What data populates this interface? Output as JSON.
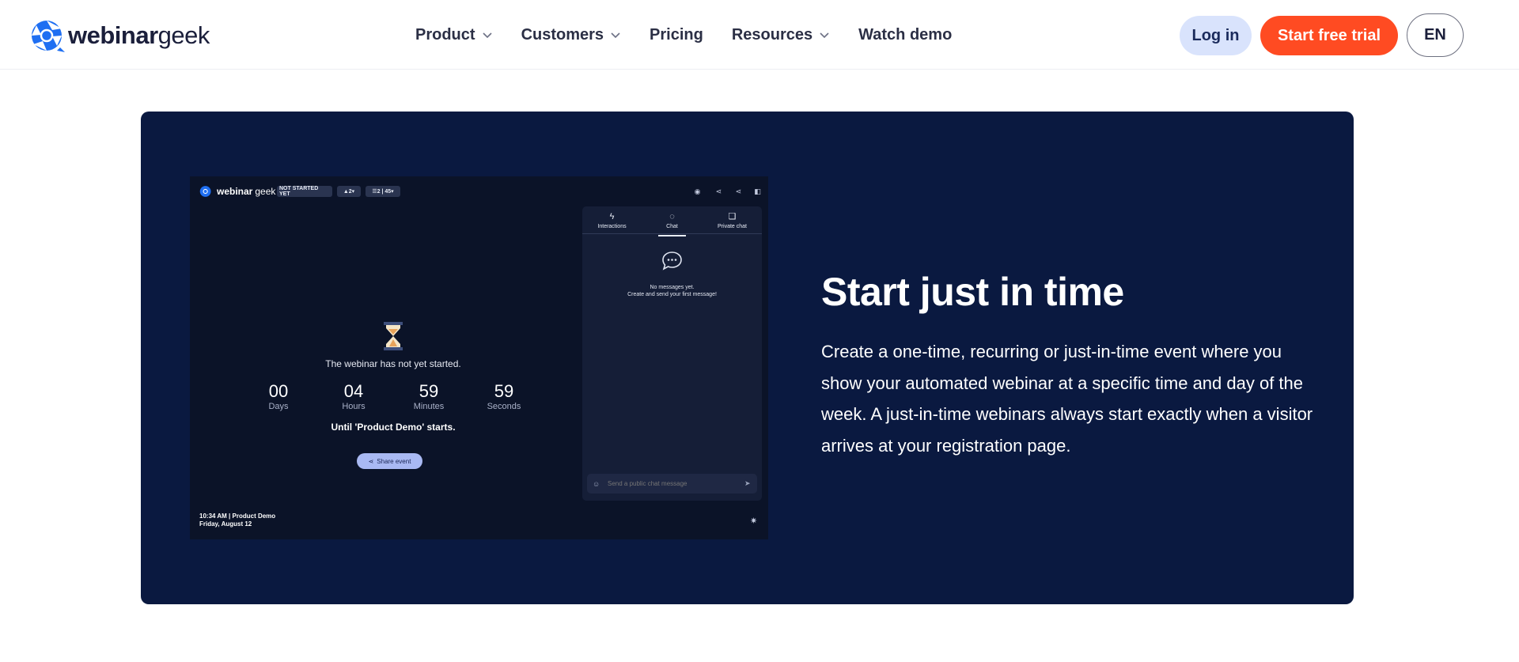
{
  "header": {
    "logo": {
      "part1": "webinar",
      "part2": "geek"
    },
    "nav": [
      {
        "label": "Product",
        "has_dropdown": true
      },
      {
        "label": "Customers",
        "has_dropdown": true
      },
      {
        "label": "Pricing",
        "has_dropdown": false
      },
      {
        "label": "Resources",
        "has_dropdown": true
      },
      {
        "label": "Watch demo",
        "has_dropdown": false
      }
    ],
    "login_label": "Log in",
    "trial_label": "Start free trial",
    "lang_label": "EN"
  },
  "colors": {
    "brand_blue": "#1f6ff2",
    "cta_orange": "#ff4b22",
    "card_navy": "#0a1940",
    "login_bg": "#d9e3fc"
  },
  "hero": {
    "title": "Start just in time",
    "body": "Create a one-time, recurring or just-in-time event where you show your automated webinar at a specific time and day of the week. A just-in-time webinars always start exactly when a visitor arrives at your registration page."
  },
  "preview": {
    "logo": {
      "part1": "webinar",
      "part2": "geek"
    },
    "status_badge": "NOT STARTED YET",
    "badge_presenters": "2",
    "badge_attendees": "2 | 45",
    "not_started_text": "The webinar has not yet started.",
    "countdown": [
      {
        "value": "00",
        "unit": "Days"
      },
      {
        "value": "04",
        "unit": "Hours"
      },
      {
        "value": "59",
        "unit": "Minutes"
      },
      {
        "value": "59",
        "unit": "Seconds"
      }
    ],
    "until_text": "Until 'Product Demo' starts.",
    "share_label": "Share event",
    "footer_time": "10:34 AM | Product Demo",
    "footer_date": "Friday, August 12",
    "tabs": [
      {
        "label": "Interactions",
        "icon": "bolt-icon"
      },
      {
        "label": "Chat",
        "icon": "chat-bubble-icon"
      },
      {
        "label": "Private chat",
        "icon": "private-chat-icon"
      }
    ],
    "active_tab": "Chat",
    "no_messages": "No messages yet.",
    "no_messages_sub": "Create and send your first message!",
    "chat_placeholder": "Send a public chat message"
  }
}
